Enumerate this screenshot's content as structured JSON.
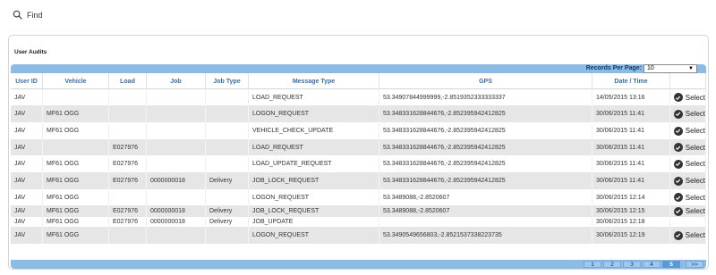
{
  "find": {
    "label": "Find",
    "icon": "search-icon"
  },
  "panel": {
    "title": "User Audits"
  },
  "records_per_page": {
    "label": "Records Per Page:",
    "value": "10"
  },
  "columns": [
    "User ID",
    "Vehicle",
    "Load",
    "Job",
    "Job Type",
    "Message Type",
    "GPS",
    "Date / Time",
    ""
  ],
  "rows": [
    {
      "user_id": "JAV",
      "vehicle": "",
      "load": "",
      "job": "",
      "job_type": "",
      "message_type": "LOAD_REQUEST",
      "gps": "53.34907844999999,-2.8519352333333337",
      "datetime": "14/05/2015 13:16",
      "select": "Select"
    },
    {
      "user_id": "JAV",
      "vehicle": "MF61 OGG",
      "load": "",
      "job": "",
      "job_type": "",
      "message_type": "LOGON_REQUEST",
      "gps": "53.348331628844676,-2.852395942412825",
      "datetime": "30/06/2015 11:41",
      "select": "Select"
    },
    {
      "user_id": "JAV",
      "vehicle": "MF61 OGG",
      "load": "",
      "job": "",
      "job_type": "",
      "message_type": "VEHICLE_CHECK_UPDATE",
      "gps": "53.348331628844676,-2.852395942412825",
      "datetime": "30/06/2015 11:41",
      "select": "Select"
    },
    {
      "user_id": "JAV",
      "vehicle": "",
      "load": "E027976",
      "job": "",
      "job_type": "",
      "message_type": "LOAD_REQUEST",
      "gps": "53.348331628844676,-2.852395942412825",
      "datetime": "30/06/2015 11:41",
      "select": "Select"
    },
    {
      "user_id": "JAV",
      "vehicle": "MF61 OGG",
      "load": "E027976",
      "job": "",
      "job_type": "",
      "message_type": "LOAD_UPDATE_REQUEST",
      "gps": "53.348331628844676,-2.852395942412825",
      "datetime": "30/06/2015 11:41",
      "select": "Select"
    },
    {
      "user_id": "JAV",
      "vehicle": "MF61 OGG",
      "load": "E027976",
      "job": "0000000018",
      "job_type": "Delivery",
      "message_type": "JOB_LOCK_REQUEST",
      "gps": "53.348331628844676,-2.852395942412825",
      "datetime": "30/06/2015 11:41",
      "select": "Select"
    },
    {
      "user_id": "JAV",
      "vehicle": "MF61 OGG",
      "load": "",
      "job": "",
      "job_type": "",
      "message_type": "LOGON_REQUEST",
      "gps": "53.3489088,-2.8520607",
      "datetime": "30/06/2015 12:14",
      "select": "Select"
    },
    {
      "user_id": "JAV",
      "vehicle": "MF61 OGG",
      "load": "E027976",
      "job": "0000000018",
      "job_type": "Delivery",
      "message_type": "JOB_LOCK_REQUEST",
      "gps": "53.3489088,-2.8520607",
      "datetime": "30/06/2015 12:15",
      "select": "Select"
    },
    {
      "user_id": "JAV",
      "vehicle": "MF61 OGG",
      "load": "E027976",
      "job": "0000000018",
      "job_type": "Delivery",
      "message_type": "JOB_UPDATE",
      "gps": "",
      "datetime": "30/06/2015 12:18",
      "select": ""
    },
    {
      "user_id": "JAV",
      "vehicle": "MF61 OGG",
      "load": "",
      "job": "",
      "job_type": "",
      "message_type": "LOGON_REQUEST",
      "gps": "53.3490549656803,-2.8521537338223735",
      "datetime": "30/06/2015 12:19",
      "select": "Select"
    }
  ],
  "pager": {
    "pages": [
      "1",
      "2",
      "3",
      "4",
      "5"
    ],
    "active": "5",
    "next": ">>"
  },
  "colors": {
    "accent": "#8dbbe4",
    "header_text": "#3a6fa5",
    "row_alt": "#e6e6e6"
  }
}
